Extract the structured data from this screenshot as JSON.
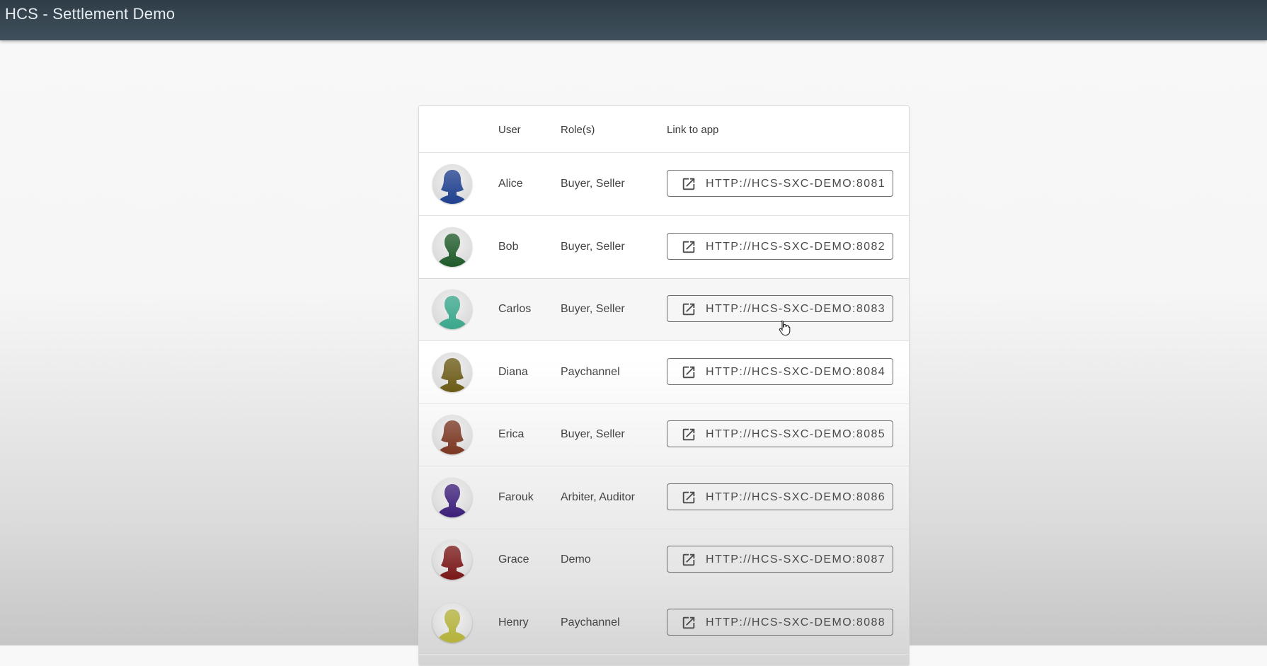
{
  "app": {
    "title": "HCS - Settlement Demo"
  },
  "table": {
    "headers": {
      "user": "User",
      "roles": "Role(s)",
      "link": "Link to app"
    },
    "rows": [
      {
        "user": "Alice",
        "roles": "Buyer, Seller",
        "link": "HTTP://HCS-SXC-DEMO:8081",
        "avatar_color": "#1e3f8f",
        "avatar_icon": "female-silhouette-icon"
      },
      {
        "user": "Bob",
        "roles": "Buyer, Seller",
        "link": "HTTP://HCS-SXC-DEMO:8082",
        "avatar_color": "#1f5b2a",
        "avatar_icon": "male-silhouette-icon"
      },
      {
        "user": "Carlos",
        "roles": "Buyer, Seller",
        "link": "HTTP://HCS-SXC-DEMO:8083",
        "avatar_color": "#3aa88c",
        "avatar_icon": "male-silhouette-icon"
      },
      {
        "user": "Diana",
        "roles": "Paychannel",
        "link": "HTTP://HCS-SXC-DEMO:8084",
        "avatar_color": "#6b5a14",
        "avatar_icon": "female-silhouette-icon"
      },
      {
        "user": "Erica",
        "roles": "Buyer, Seller",
        "link": "HTTP://HCS-SXC-DEMO:8085",
        "avatar_color": "#7a3520",
        "avatar_icon": "female-silhouette-icon"
      },
      {
        "user": "Farouk",
        "roles": "Arbiter, Auditor",
        "link": "HTTP://HCS-SXC-DEMO:8086",
        "avatar_color": "#3c1f7a",
        "avatar_icon": "male-silhouette-icon"
      },
      {
        "user": "Grace",
        "roles": "Demo",
        "link": "HTTP://HCS-SXC-DEMO:8087",
        "avatar_color": "#7a1616",
        "avatar_icon": "female-silhouette-icon"
      },
      {
        "user": "Henry",
        "roles": "Paychannel",
        "link": "HTTP://HCS-SXC-DEMO:8088",
        "avatar_color": "#b5b33a",
        "avatar_icon": "male-silhouette-icon"
      }
    ],
    "highlighted_row": 2
  }
}
